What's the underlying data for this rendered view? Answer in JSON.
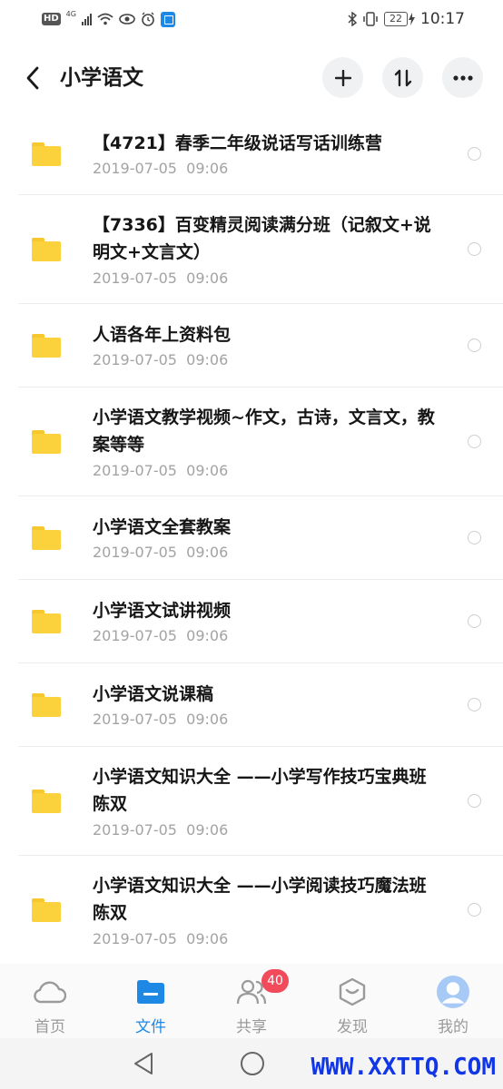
{
  "status_bar": {
    "hd": "HD",
    "network": "4G",
    "battery": "22",
    "time": "10:17"
  },
  "header": {
    "title": "小学语文",
    "back_icon": "back-arrow-icon",
    "add_icon": "plus-icon",
    "sort_icon": "sort-icon",
    "more_icon": "more-icon"
  },
  "files": [
    {
      "title": "【4721】春季二年级说话写话训练营",
      "date": "2019-07-05  09:06"
    },
    {
      "title": "【7336】百变精灵阅读满分班（记叙文+说明文+文言文）",
      "date": "2019-07-05  09:06"
    },
    {
      "title": "人语各年上资料包",
      "date": "2019-07-05  09:06"
    },
    {
      "title": "小学语文教学视频~作文，古诗，文言文，教案等等",
      "date": "2019-07-05  09:06"
    },
    {
      "title": "小学语文全套教案",
      "date": "2019-07-05  09:06"
    },
    {
      "title": "小学语文试讲视频",
      "date": "2019-07-05  09:06"
    },
    {
      "title": "小学语文说课稿",
      "date": "2019-07-05  09:06"
    },
    {
      "title": "小学语文知识大全 ——小学写作技巧宝典班 陈双",
      "date": "2019-07-05  09:06"
    },
    {
      "title": "小学语文知识大全 ——小学阅读技巧魔法班 陈双",
      "date": "2019-07-05  09:06"
    }
  ],
  "bottom_nav": {
    "items": [
      {
        "label": "首页",
        "icon": "cloud-icon"
      },
      {
        "label": "文件",
        "icon": "folder-icon",
        "active": true
      },
      {
        "label": "共享",
        "icon": "people-icon",
        "badge": "40"
      },
      {
        "label": "发现",
        "icon": "discover-icon"
      },
      {
        "label": "我的",
        "icon": "avatar-icon"
      }
    ]
  },
  "watermark": "WWW.XXTTQ.COM",
  "colors": {
    "accent": "#1e88e5",
    "folder": "#fbd13c",
    "badge": "#f24a5b",
    "watermark": "#1136e6"
  }
}
